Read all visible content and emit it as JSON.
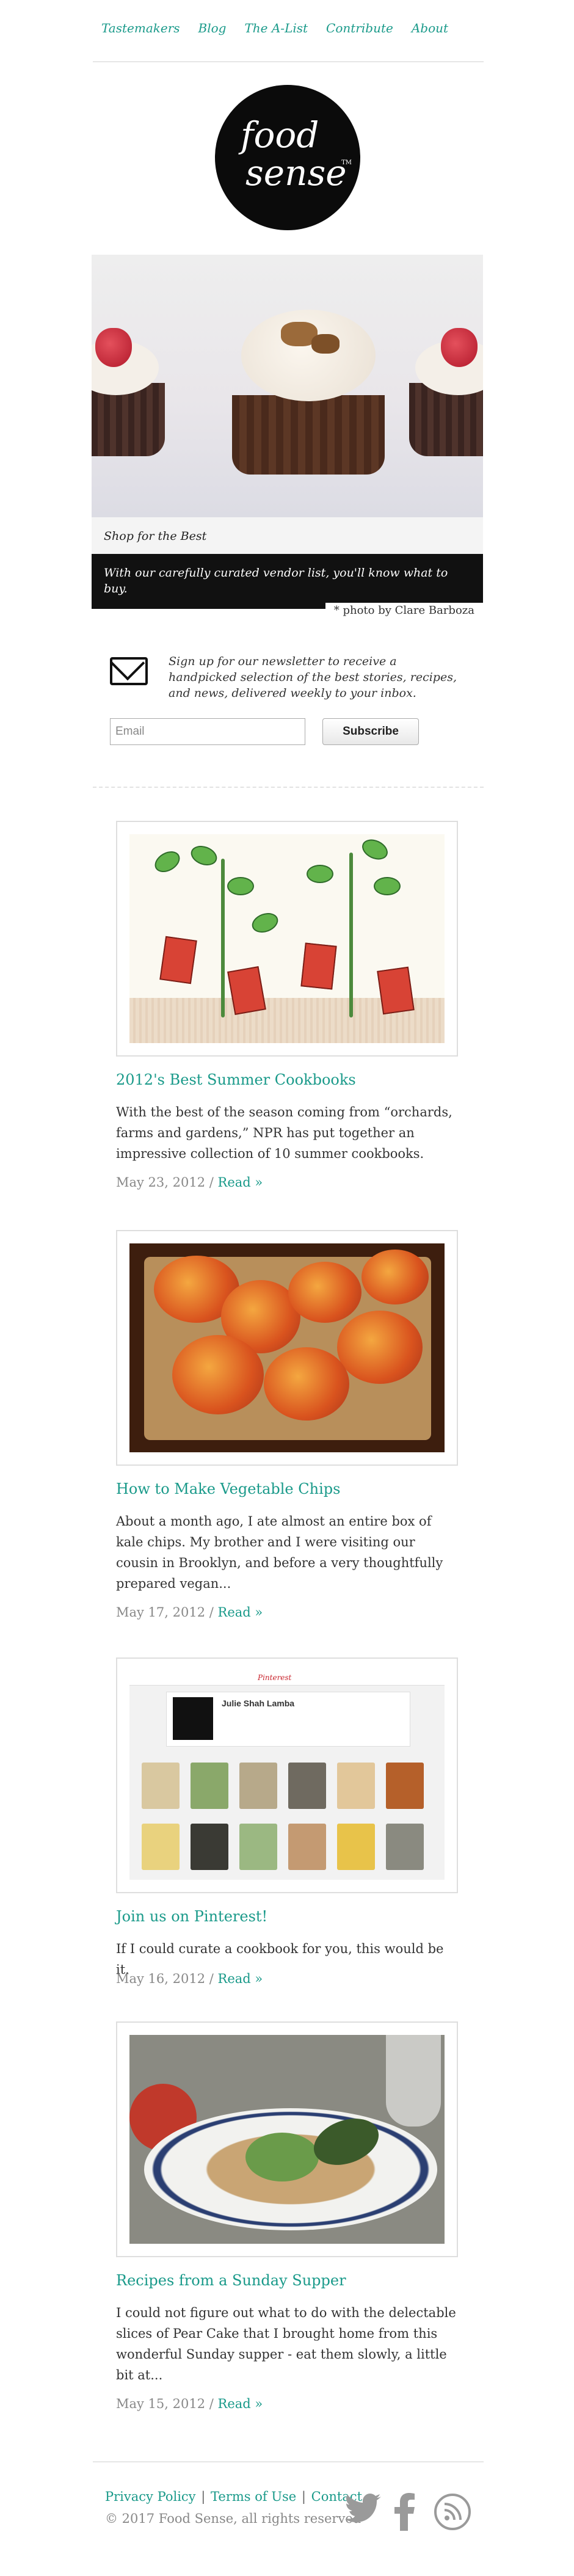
{
  "nav": {
    "items": [
      {
        "label": "Tastemakers"
      },
      {
        "label": "Blog"
      },
      {
        "label": "The A-List"
      },
      {
        "label": "Contribute"
      },
      {
        "label": "About"
      }
    ]
  },
  "logo": {
    "line1": "food",
    "line2": "sense",
    "tm": "TM"
  },
  "hero": {
    "title": "Shop for the Best",
    "tagline": "With our carefully curated vendor list, you'll know what to buy.",
    "credit": "* photo by Clare Barboza"
  },
  "newsletter": {
    "text": "Sign up for our newsletter to receive a handpicked selection of the best stories, recipes, and news, delivered weekly to your inbox.",
    "placeholder": "Email",
    "button": "Subscribe"
  },
  "posts": [
    {
      "title": "2012's Best Summer Cookbooks",
      "excerpt": "With the best of the season coming from “orchards, farms and gardens,” NPR has put together an impressive collection of 10 summer cookbooks.",
      "date": "May 23, 2012 /",
      "read_more": "Read »"
    },
    {
      "title": "How to Make Vegetable Chips",
      "excerpt": "About a month ago, I ate almost an entire box of kale chips. My brother and I were visiting our cousin in Brooklyn, and before a very thoughtfully prepared vegan...",
      "date": "May 17, 2012 /",
      "read_more": "Read »"
    },
    {
      "title": "Join us on Pinterest!",
      "excerpt": "If I could curate a cookbook for you, this would be it.",
      "date": "May 16, 2012 /",
      "read_more": "Read »",
      "thumb_text": {
        "brand": "Pinterest",
        "name": "Julie Shah Lamba"
      }
    },
    {
      "title": "Recipes from a Sunday Supper",
      "excerpt": "I could not figure out what to do with the delectable slices of Pear Cake that I brought home from this wonderful Sunday supper - eat them slowly, a little bit at...",
      "date": "May 15, 2012 /",
      "read_more": "Read »"
    }
  ],
  "footer": {
    "links": [
      {
        "label": "Privacy Policy"
      },
      {
        "label": "Terms of Use"
      },
      {
        "label": "Contact"
      }
    ],
    "separator": "|",
    "copyright": "© 2017 Food Sense, all rights reserved",
    "social_icons": [
      "twitter-icon",
      "facebook-icon",
      "rss-icon"
    ]
  },
  "colors": {
    "link": "#1a9a8a",
    "text": "#333333",
    "muted": "#888888",
    "dark": "#111111"
  }
}
